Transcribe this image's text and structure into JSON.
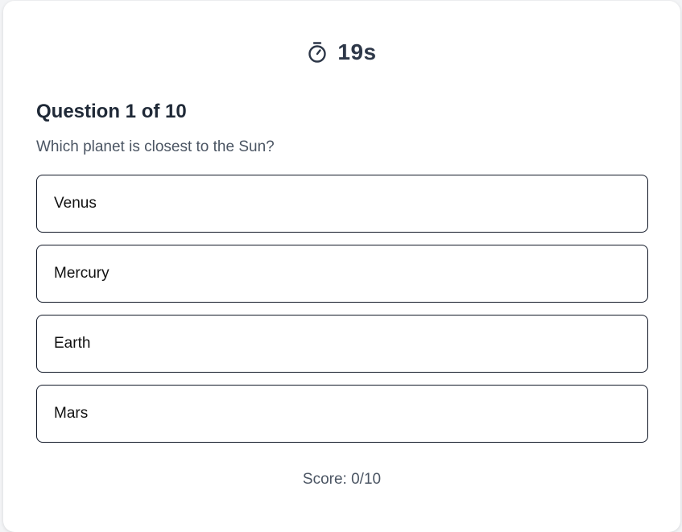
{
  "timer": {
    "icon": "stopwatch-icon",
    "value": "19s"
  },
  "question": {
    "title": "Question 1 of 10",
    "text": "Which planet is closest to the Sun?"
  },
  "options": [
    {
      "label": "Venus"
    },
    {
      "label": "Mercury"
    },
    {
      "label": "Earth"
    },
    {
      "label": "Mars"
    }
  ],
  "score": {
    "text": "Score: 0/10"
  }
}
